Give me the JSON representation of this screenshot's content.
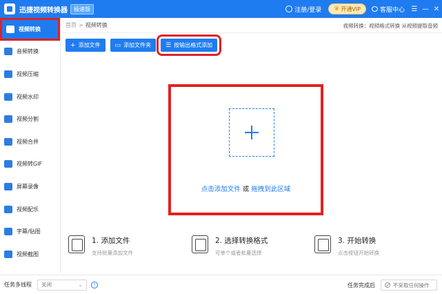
{
  "app": {
    "title": "迅捷视频转换器",
    "badge": "极速版"
  },
  "titlebar": {
    "login": "注册/登录",
    "vip": "开通VIP",
    "service": "客服中心",
    "menu_glyph": "☰",
    "minimize_glyph": "—",
    "close_glyph": "✕"
  },
  "sidebar": {
    "items": [
      {
        "label": "视频转换",
        "icon": "video-convert-icon",
        "active": true
      },
      {
        "label": "音频转换",
        "icon": "audio-convert-icon"
      },
      {
        "label": "视频压缩",
        "icon": "video-compress-icon"
      },
      {
        "label": "视频水印",
        "icon": "video-watermark-icon"
      },
      {
        "label": "视频分割",
        "icon": "video-split-icon"
      },
      {
        "label": "视频合并",
        "icon": "video-merge-icon"
      },
      {
        "label": "视频转GIF",
        "icon": "video-gif-icon"
      },
      {
        "label": "屏幕录像",
        "icon": "screen-record-icon"
      },
      {
        "label": "视频配乐",
        "icon": "video-music-icon"
      },
      {
        "label": "字幕/贴图",
        "icon": "subtitle-sticker-icon"
      },
      {
        "label": "视频截图",
        "icon": "video-screenshot-icon"
      }
    ]
  },
  "breadcrumb": {
    "home": "首页",
    "sep": ">",
    "current": "视频转换",
    "tip": "视频转换：视频格式转换 从视频提取音频"
  },
  "toolbar": {
    "add_file": "添加文件",
    "add_folder": "添加文件夹",
    "add_by_format": "按输出格式添加",
    "add_file_glyph": "+",
    "add_folder_glyph": "▭",
    "add_by_format_glyph": "☰"
  },
  "dropzone": {
    "click_text": "点击添加文件",
    "or_text": "或",
    "drag_text": "拖拽到此区域"
  },
  "steps": [
    {
      "title": "1. 添加文件",
      "sub": "支持批量添加文件"
    },
    {
      "title": "2. 选择转换格式",
      "sub": "可单个或者批量选择"
    },
    {
      "title": "3. 开始转换",
      "sub": "点击按钮开始转换"
    }
  ],
  "bottombar": {
    "multithread_label": "任务多线程",
    "multithread_value": "关闭",
    "info_glyph": "!",
    "after_label": "任务完成后",
    "after_value": "不采取任何操作"
  },
  "colors": {
    "accent": "#1f7cf0",
    "highlight": "#e02222"
  }
}
